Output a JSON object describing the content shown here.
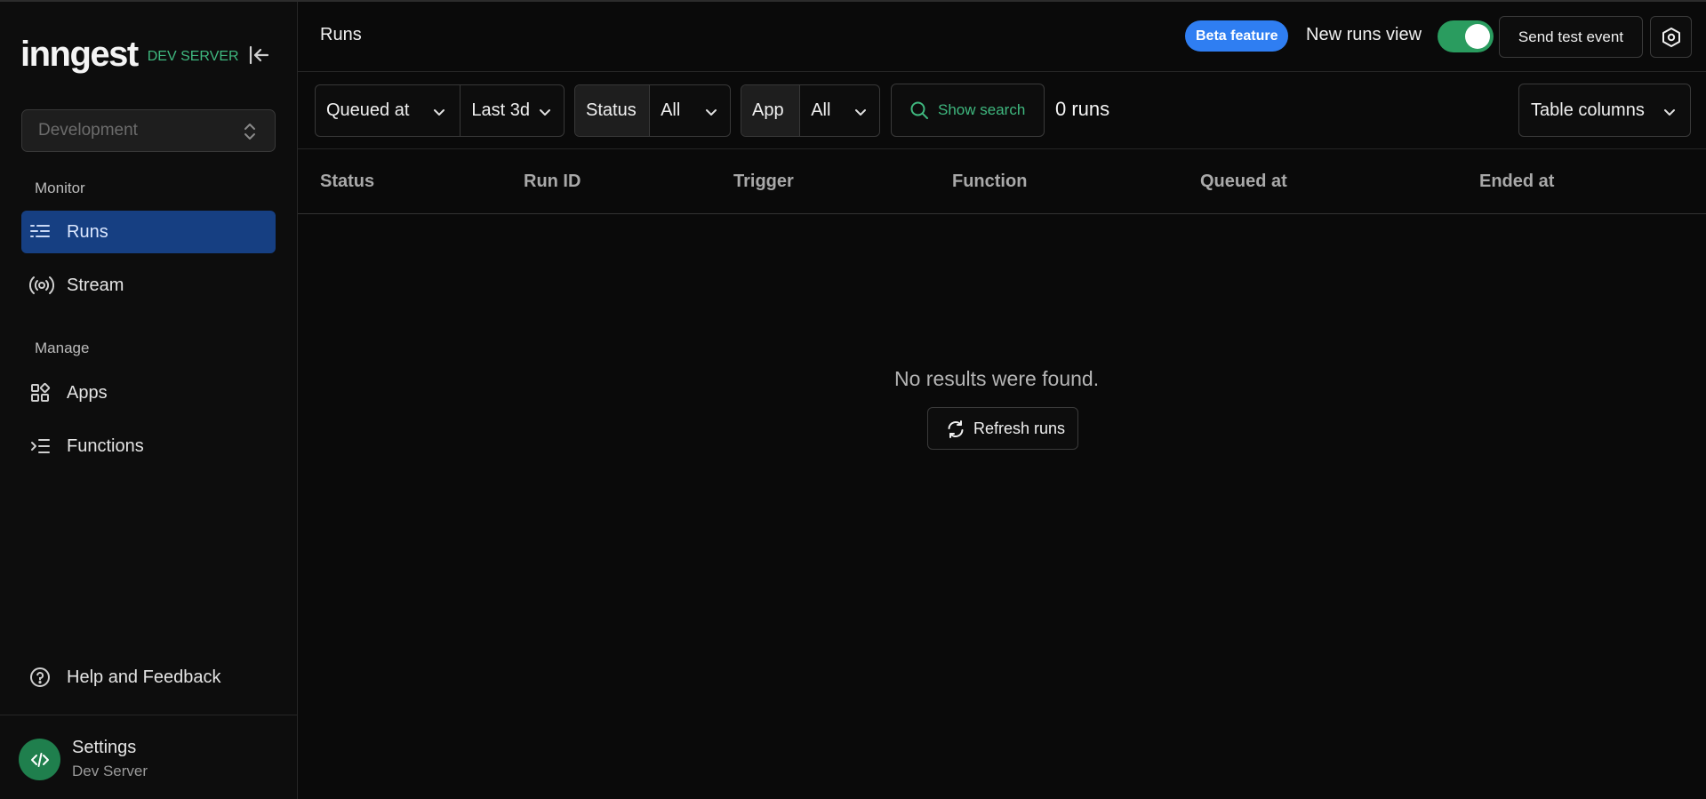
{
  "brand": {
    "logo": "inngest",
    "tag": "DEV SERVER",
    "accent_green": "#3fb87f"
  },
  "sidebar": {
    "environment": "Development",
    "sections": {
      "monitor": "Monitor",
      "manage": "Manage"
    },
    "items": {
      "runs": {
        "label": "Runs",
        "icon": "runs-list-icon",
        "active": true
      },
      "stream": {
        "label": "Stream",
        "icon": "broadcast-icon"
      },
      "apps": {
        "label": "Apps",
        "icon": "apps-grid-icon"
      },
      "functions": {
        "label": "Functions",
        "icon": "functions-list-icon"
      }
    },
    "help": "Help and Feedback",
    "settings": {
      "title": "Settings",
      "subtitle": "Dev Server",
      "icon": "code-icon"
    },
    "active_color": "#163f82"
  },
  "header": {
    "title": "Runs",
    "beta_badge": "Beta feature",
    "beta_color": "#2f7ef2",
    "toggle_label": "New runs view",
    "toggle_on": true,
    "toggle_color": "#2a9c5f",
    "send_test_event": "Send test event",
    "settings_icon": "hexagon-gear-icon"
  },
  "filters": {
    "time_field": "Queued at",
    "time_range": "Last 3d",
    "status_label": "Status",
    "status_value": "All",
    "app_label": "App",
    "app_value": "All",
    "search": "Show search",
    "runs_count": "0 runs",
    "table_columns": "Table columns"
  },
  "table": {
    "columns": [
      "Status",
      "Run ID",
      "Trigger",
      "Function",
      "Queued at",
      "Ended at"
    ],
    "rows": [],
    "empty_message": "No results were found.",
    "refresh_label": "Refresh runs"
  }
}
